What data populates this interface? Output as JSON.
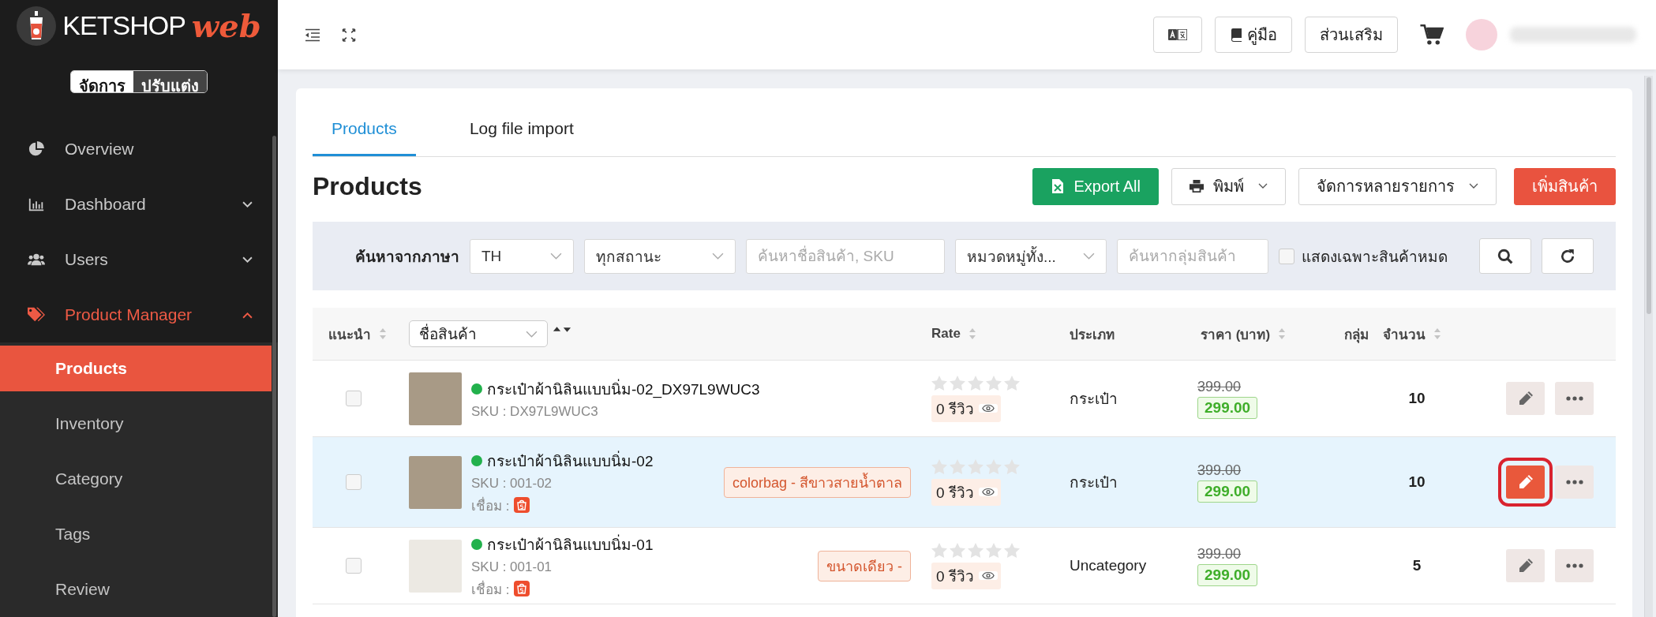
{
  "sidebar": {
    "brand": {
      "name": "KETSHOP",
      "suffix": "web"
    },
    "mode_toggle": [
      {
        "label": "จัดการ",
        "selected": true
      },
      {
        "label": "ปรับแต่ง",
        "selected": false
      }
    ],
    "items": [
      {
        "label": "Overview",
        "kind": "link",
        "selected": false
      },
      {
        "label": "Dashboard",
        "kind": "group",
        "expanded": false,
        "selected": false
      },
      {
        "label": "Users",
        "kind": "group",
        "expanded": false,
        "selected": false
      },
      {
        "label": "Product Manager",
        "kind": "group",
        "expanded": true,
        "selected": true,
        "children": [
          {
            "label": "Products",
            "selected": true
          },
          {
            "label": "Inventory",
            "selected": false
          },
          {
            "label": "Category",
            "selected": false
          },
          {
            "label": "Tags",
            "selected": false
          },
          {
            "label": "Review",
            "selected": false
          }
        ]
      }
    ]
  },
  "header": {
    "buttons": [
      {
        "label": "คู่มือ"
      },
      {
        "label": "ส่วนเสริม"
      }
    ]
  },
  "tabs": [
    {
      "label": "Products",
      "selected": true
    },
    {
      "label": "Log file import",
      "selected": false
    }
  ],
  "page_title": "Products",
  "actions": [
    {
      "label": "Export All",
      "kind": "export"
    },
    {
      "label": "พิมพ์",
      "kind": "print"
    },
    {
      "label": "จัดการหลายรายการ",
      "kind": "menu"
    },
    {
      "label": "เพิ่มสินค้า",
      "kind": "add"
    }
  ],
  "filters": {
    "label": "ค้นหาจากภาษา",
    "fields": [
      {
        "kind": "select",
        "value": "TH"
      },
      {
        "kind": "select",
        "value": "ทุกสถานะ"
      },
      {
        "kind": "input",
        "placeholder": "ค้นหาชื่อสินค้า, SKU"
      },
      {
        "kind": "select",
        "value": "หมวดหมู่ทั้ง..."
      },
      {
        "kind": "input",
        "placeholder": "ค้นหากลุ่มสินค้า"
      }
    ],
    "checkbox": {
      "label": "แสดงเฉพาะสินค้าหมด",
      "checked": false
    }
  },
  "table": {
    "columns": [
      {
        "label": "แนะนำ",
        "kind": "sort"
      },
      {
        "label": "ชื่อสินค้า",
        "kind": "select"
      },
      {
        "label": "Rate",
        "kind": "sort"
      },
      {
        "label": "ประเภท",
        "kind": "plain"
      },
      {
        "label": "ราคา (บาท)",
        "kind": "sort"
      },
      {
        "label": "กลุ่ม",
        "kind": "plain"
      },
      {
        "label": "จำนวน",
        "kind": "sort"
      }
    ],
    "rows": [
      {
        "selected": false,
        "recommended": false,
        "active": true,
        "name": "กระเป๋าผ้านิลินแบบนิ่ม-02_DX97L9WUC3",
        "sku": "SKU : DX97L9WUC3",
        "stars": 0,
        "reviews": "0 รีวิว",
        "category": "กระเป๋า",
        "old_price": "399.00",
        "price": "299.00",
        "quantity": "10"
      },
      {
        "selected": true,
        "recommended": false,
        "active": true,
        "name": "กระเป๋าผ้านิลินแบบนิ่ม-02",
        "sku": "SKU : 001-02",
        "linked": "เชื่อม :",
        "variant": "colorbag - สีขาวสายน้ำตาล",
        "stars": 0,
        "reviews": "0 รีวิว",
        "category": "กระเป๋า",
        "old_price": "399.00",
        "price": "299.00",
        "quantity": "10"
      },
      {
        "selected": false,
        "recommended": false,
        "active": true,
        "name": "กระเป๋าผ้านิลินแบบนิ่ม-01",
        "sku": "SKU : 001-01",
        "linked": "เชื่อม :",
        "variant": "ขนาดเดียว -",
        "stars": 0,
        "reviews": "0 รีวิว",
        "category": "Uncategory",
        "old_price": "399.00",
        "price": "299.00",
        "quantity": "5"
      }
    ]
  }
}
